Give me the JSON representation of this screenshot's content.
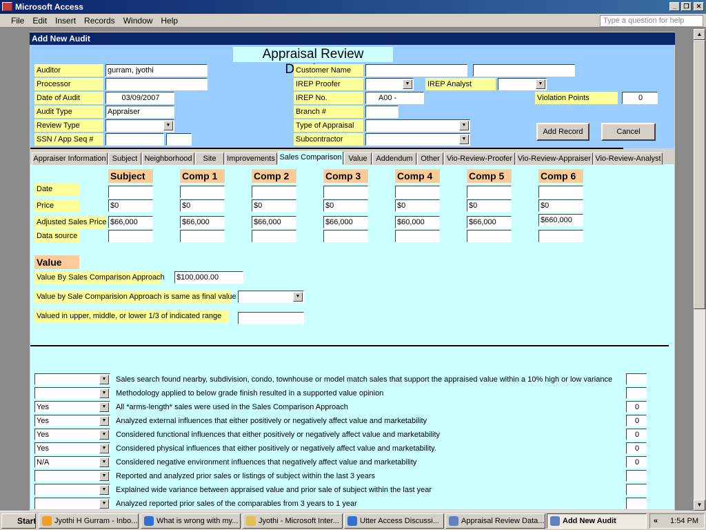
{
  "app": {
    "title": "Microsoft Access",
    "menu": [
      "File",
      "Edit",
      "Insert",
      "Records",
      "Window",
      "Help"
    ],
    "help_placeholder": "Type a question for help"
  },
  "form": {
    "title": "Add New Audit",
    "heading": "Appraisal Review Database",
    "left_fields": [
      {
        "label": "Auditor",
        "value": "gurram, jyothi"
      },
      {
        "label": "Processor",
        "value": ""
      },
      {
        "label": "Date of Audit",
        "value": "03/09/2007"
      },
      {
        "label": "Audit Type",
        "value": "Appraiser"
      },
      {
        "label": "Review Type",
        "value": ""
      },
      {
        "label": "SSN / App Seq #",
        "value": ""
      }
    ],
    "right_fields": [
      {
        "label": "Customer Name",
        "value": ""
      },
      {
        "label": "IREP Proofer",
        "value": ""
      },
      {
        "label": "IREP No.",
        "value": "A00 -"
      },
      {
        "label": "Branch #",
        "value": ""
      },
      {
        "label": "Type of Appraisal",
        "value": ""
      },
      {
        "label": "Subcontractor",
        "value": ""
      }
    ],
    "irep_analyst": {
      "label": "IREP Analyst",
      "value": ""
    },
    "violation_points": {
      "label": "Violation Points",
      "value": "0"
    },
    "add_record": "Add Record",
    "cancel": "Cancel"
  },
  "tabs": [
    "Appraiser Information",
    "Subject",
    "Neighborhood",
    "Site",
    "Improvements",
    "Sales Comparison",
    "Value",
    "Addendum",
    "Other",
    "Vio-Review-Proofer",
    "Vio-Review-Appraiser",
    "Vio-Review-Analyst"
  ],
  "active_tab": "Sales Comparison",
  "comparison": {
    "columns": [
      "Subject",
      "Comp 1",
      "Comp 2",
      "Comp 3",
      "Comp 4",
      "Comp 5",
      "Comp 6"
    ],
    "row_labels": [
      "Date",
      "Price",
      "Adjusted Sales Price",
      "Data source"
    ],
    "date": [
      "",
      "",
      "",
      "",
      "",
      "",
      ""
    ],
    "price": [
      "$0",
      "$0",
      "$0",
      "$0",
      "$0",
      "$0",
      "$0"
    ],
    "adjusted": [
      "$66,000",
      "$66,000",
      "$66,000",
      "$66,000",
      "$60,000",
      "$66,000",
      "$660,000"
    ],
    "source": [
      "",
      "",
      "",
      "",
      "",
      "",
      ""
    ]
  },
  "value": {
    "heading": "Value",
    "by_sales_label": "Value By Sales Comparison Approach",
    "by_sales_value": "$100,000.00",
    "same_label": "Value by Sale Comparision Approach is same as final value",
    "same_value": "",
    "range_label": "Valued in upper, middle, or lower 1/3 of indicated range",
    "range_value": ""
  },
  "checklist": [
    {
      "answer": "",
      "text": "Sales search found nearby, subdivision, condo, townhouse or model match sales that support the appraised value within a 10% high or low variance",
      "points": ""
    },
    {
      "answer": "",
      "text": "Methodology applied to below grade finish resulted in a supported value opinion",
      "points": ""
    },
    {
      "answer": "Yes",
      "text": "All *arms-length* sales were used in the Sales Comparison Approach",
      "points": "0"
    },
    {
      "answer": "Yes",
      "text": "Analyzed external influences that either positively or negatively affect value and marketability",
      "points": "0"
    },
    {
      "answer": "Yes",
      "text": "Considered functional influences that either positively or negatively affect value and marketability",
      "points": "0"
    },
    {
      "answer": "Yes",
      "text": "Considered physical influences that either positively or negatively affect value and marketability.",
      "points": "0"
    },
    {
      "answer": "N/A",
      "text": "Considered negative environment influences that negatively affect value and marketability",
      "points": "0"
    },
    {
      "answer": "",
      "text": "Reported and analyzed prior sales or listings of subject within the last 3 years",
      "points": ""
    },
    {
      "answer": "",
      "text": "Explained wide variance between appraised value and prior sale of subject within the last year",
      "points": ""
    },
    {
      "answer": "",
      "text": "Analyzed reported prior sales of the comparables from 3 years to 1 year",
      "points": ""
    }
  ],
  "taskbar": {
    "start": "Start",
    "items": [
      "Jyothi H Gurram - Inbo...",
      "What is wrong with my...",
      "Jyothi - Microsoft Inter...",
      "Utter Access Discussi...",
      "Appraisal Review Data...",
      "Add New Audit"
    ],
    "active": "Add New Audit",
    "clock": "1:54 PM",
    "chevron": "«"
  }
}
